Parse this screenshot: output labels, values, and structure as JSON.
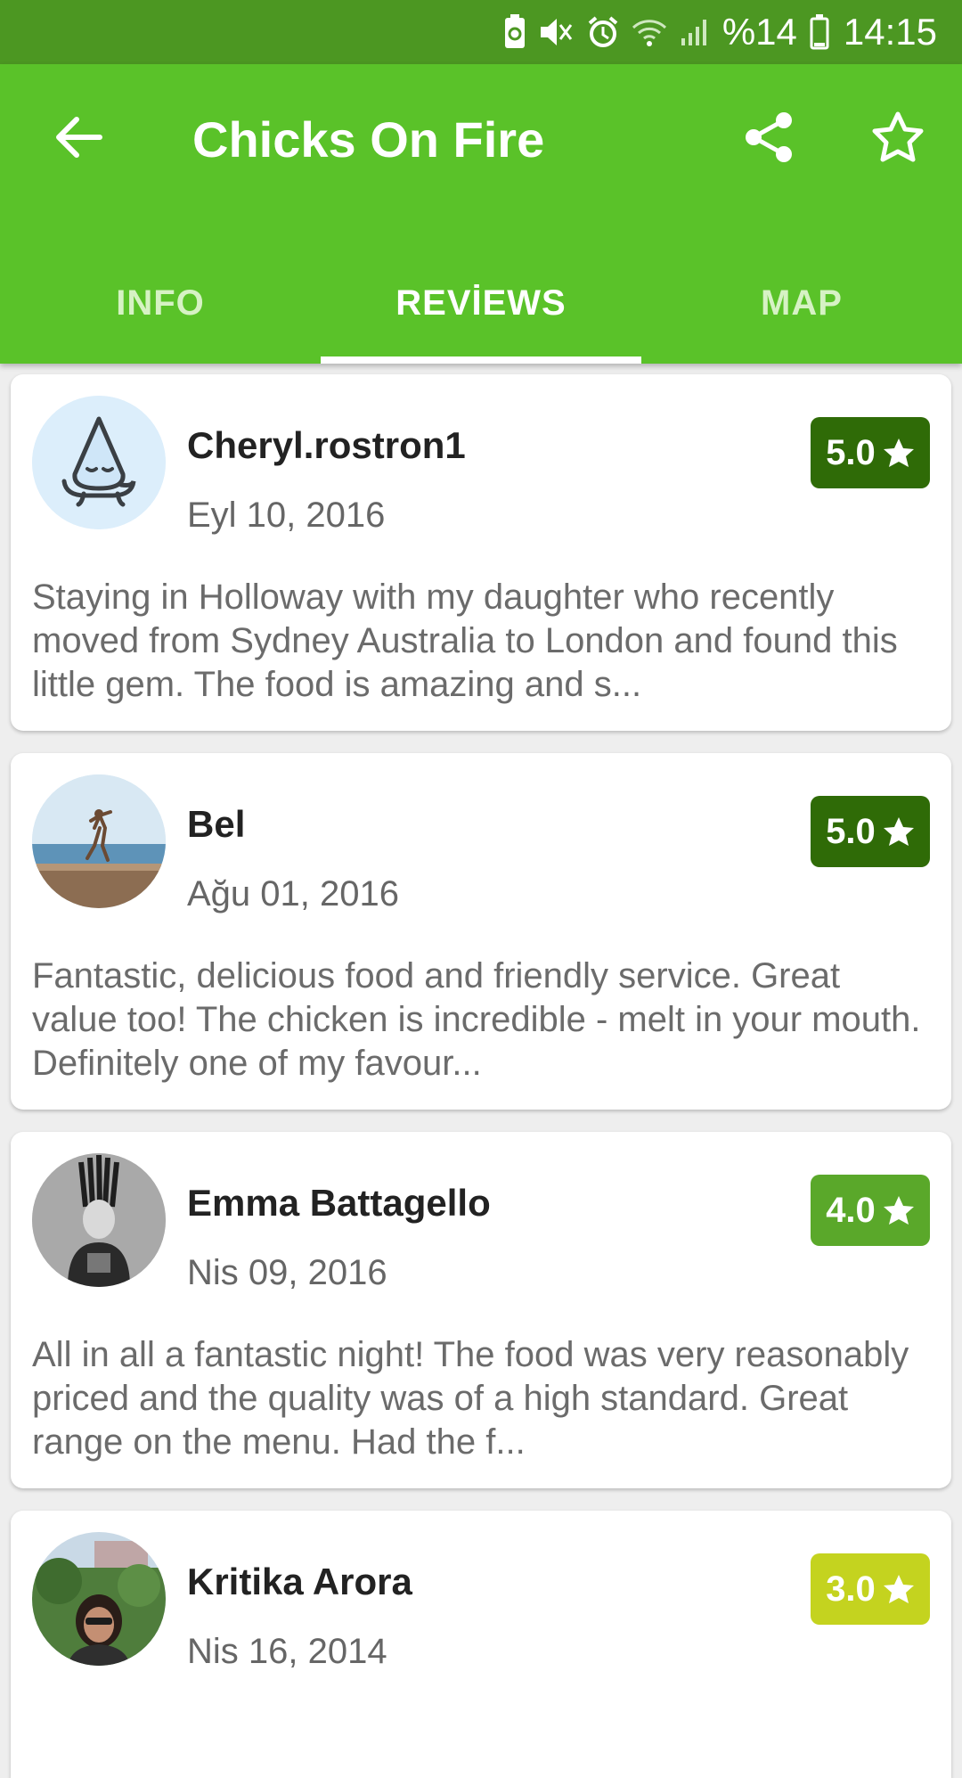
{
  "status_bar": {
    "battery_percent": "%14",
    "time": "14:15",
    "icons": [
      "battery-saver-icon",
      "mute-icon",
      "alarm-icon",
      "wifi-icon",
      "signal-icon",
      "battery-icon"
    ]
  },
  "app_bar": {
    "title": "Chicks On Fire",
    "back_icon": "arrow-left-icon",
    "share_icon": "share-icon",
    "favorite_icon": "star-outline-icon",
    "color": "#5ac229"
  },
  "tabs": [
    {
      "label": "INFO",
      "active": false
    },
    {
      "label": "REVİEWS",
      "active": true
    },
    {
      "label": "MAP",
      "active": false
    }
  ],
  "reviews": [
    {
      "author": "Cheryl.rostron1",
      "date": "Eyl 10, 2016",
      "rating": "5.0",
      "rating_color": "#2f6b07",
      "avatar": "water-drop-avatar",
      "text": "Staying in Holloway with my daughter who recently moved from Sydney Australia to London and found this little gem. The food is amazing and s..."
    },
    {
      "author": "Bel",
      "date": "Ağu 01, 2016",
      "rating": "5.0",
      "rating_color": "#2f6b07",
      "avatar": "photo-avatar-beach",
      "text": "Fantastic, delicious food and friendly service. Great value too! The chicken is incredible - melt in your mouth. Definitely one of my favour..."
    },
    {
      "author": "Emma Battagello",
      "date": "Nis 09, 2016",
      "rating": "4.0",
      "rating_color": "#5aa82a",
      "avatar": "photo-avatar-bw",
      "text": "All in all a fantastic night! The food was very reasonably priced and the quality was of a high standard. Great range on the menu. Had the f..."
    },
    {
      "author": "Kritika Arora",
      "date": "Nis 16, 2014",
      "rating": "3.0",
      "rating_color": "#c4d31f",
      "avatar": "photo-avatar-outdoor",
      "text": ""
    }
  ]
}
